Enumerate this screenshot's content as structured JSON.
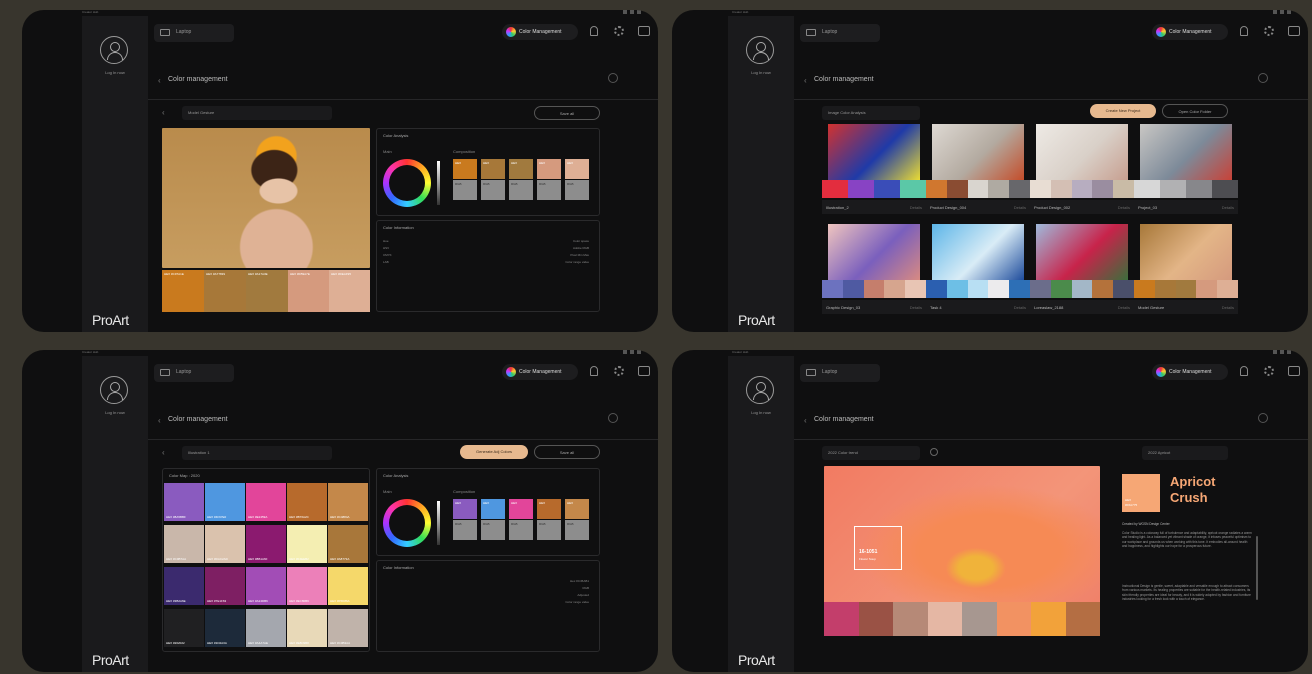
{
  "panels": {
    "common": {
      "login_label": "Log In now",
      "proart": "ProArt",
      "laptop": "Laptop",
      "color_management_chip": "Color Management",
      "page_title": "Color management",
      "window_title": "Creator Hub"
    },
    "p1": {
      "dropdown": "Model Gesture",
      "button": "Save all",
      "color_analysis_title": "Color Analysis",
      "color_wheel_label": "Main",
      "swatch_label": "Composition",
      "color_info_title": "Color Information",
      "info_rows": [
        "Hue",
        "HSV",
        "CMYK",
        "LAB"
      ],
      "info_values": [
        "Color space",
        "Adobe RGB",
        "Pixel Min Max",
        "Color range value"
      ],
      "palette": [
        {
          "hex": "#c97a1e",
          "label": "HEX #C97A1E"
        },
        {
          "hex": "#a77839",
          "label": "HEX #A77839"
        },
        {
          "hex": "#a17a3e",
          "label": "HEX #A17A3E"
        },
        {
          "hex": "#d59a7e",
          "label": "HEX #D59A7E"
        },
        {
          "hex": "#deaf95",
          "label": "HEX #DEAF95"
        }
      ],
      "tiles": [
        "#c97a1e",
        "#a77839",
        "#a17a3e",
        "#d59a7e",
        "#deaf95"
      ]
    },
    "p2": {
      "dropdown": "Image Color Analysis",
      "gold_button": "Create New Project",
      "outline_button": "Open Color Folder",
      "cards": [
        {
          "name": "Illustration_2",
          "meta": "Details",
          "strip": [
            "#e32d3e",
            "#8843c4",
            "#3a4db8",
            "#5bc8a7"
          ],
          "img": [
            "#d2322f",
            "#1f3aa8",
            "#e9db34"
          ]
        },
        {
          "name": "Product Design_004",
          "meta": "Details",
          "strip": [
            "#d0772f",
            "#8a4c32",
            "#d9d5cf",
            "#afaaa2",
            "#67676b"
          ],
          "img": [
            "#ded9d3",
            "#b3aaa0",
            "#c44d2a"
          ]
        },
        {
          "name": "Product Design_002",
          "meta": "Details",
          "strip": [
            "#e8ddd3",
            "#d4bfb4",
            "#b7adc0",
            "#9a8da0",
            "#c9bba6"
          ],
          "img": [
            "#eeeae5",
            "#d9d0c8",
            "#c79f90"
          ]
        },
        {
          "name": "Project_03",
          "meta": "Details",
          "strip": [
            "#d7d7d7",
            "#b1b1b3",
            "#87878b",
            "#4d4d51"
          ],
          "img": [
            "#c9c7c4",
            "#7d8a99",
            "#c84238"
          ]
        },
        {
          "name": "Graphic Design_03",
          "meta": "Details",
          "strip": [
            "#6c72bf",
            "#4f5aa2",
            "#c57e6c",
            "#d6a58e",
            "#e8c5b4"
          ],
          "img": [
            "#f0c5bf",
            "#7a5fbd",
            "#d88a82"
          ]
        },
        {
          "name": "Task 4",
          "meta": "Details",
          "strip": [
            "#2b5fb0",
            "#6dbfe6",
            "#b8dff3",
            "#ecebed",
            "#2d6fb6"
          ],
          "img": [
            "#5cb5e8",
            "#d9ecf6",
            "#1e4c9c"
          ]
        },
        {
          "name": "Loreaslaw_2188",
          "meta": "Details",
          "strip": [
            "#6b6d8b",
            "#4b8b4b",
            "#a3b7c7",
            "#b4723b",
            "#4a4f6a"
          ],
          "img": [
            "#9fbadc",
            "#c8234a",
            "#3c6e3c"
          ]
        },
        {
          "name": "Model Gesture",
          "meta": "Details",
          "strip": [
            "#c97a1e",
            "#a77839",
            "#a17a3e",
            "#d59a7e",
            "#deaf95"
          ],
          "img": [
            "#a77839",
            "#e3b587",
            "#d59a7e"
          ]
        }
      ]
    },
    "p3": {
      "dropdown": "Illustration 1",
      "gold_button": "Generate Adj Colors",
      "outline_button": "Save all",
      "grid_title": "Color Map : 2020",
      "color_analysis_title": "Color Analysis",
      "color_wheel_label": "Main",
      "swatch_label": "Composition",
      "color_info_title": "Color Information",
      "info_values": [
        "Hex #C45AB1",
        "RGB",
        "Adjusted",
        "Color range value"
      ],
      "grid": [
        {
          "hex": "#8a5bbf",
          "label": "HEX #8A5BBF"
        },
        {
          "hex": "#4f97e0",
          "label": "HEX #4F97E0"
        },
        {
          "hex": "#e2459a",
          "label": "HEX #E2459A"
        },
        {
          "hex": "#b76a2c",
          "label": "HEX #B76A2C"
        },
        {
          "hex": "#c4884a",
          "label": "HEX #C4884A"
        },
        {
          "hex": "#c9b7aa",
          "label": "HEX #C9B7AA"
        },
        {
          "hex": "#dac2ad",
          "label": "HEX #DAC2AD"
        },
        {
          "hex": "#8b1a6f",
          "label": "HEX #8B1A6F"
        },
        {
          "hex": "#f4eeb2",
          "label": "HEX #F4EEB2"
        },
        {
          "hex": "#a8773a",
          "label": "HEX #A8773A"
        },
        {
          "hex": "#3b2a6e",
          "label": "HEX #3B2A6E"
        },
        {
          "hex": "#7e1f63",
          "label": "HEX #7E1F63"
        },
        {
          "hex": "#a24db6",
          "label": "HEX #A24DB6"
        },
        {
          "hex": "#ec80b9",
          "label": "HEX #EC80B9"
        },
        {
          "hex": "#f5d86a",
          "label": "HEX #F5D86A"
        },
        {
          "hex": "#202022",
          "label": "HEX #202022"
        },
        {
          "hex": "#1d2a3a",
          "label": "HEX #1D2A3A"
        },
        {
          "hex": "#a4a7ae",
          "label": "HEX #A4A7AE"
        },
        {
          "hex": "#e8d9b8",
          "label": "HEX #E8D9B8"
        },
        {
          "hex": "#c0b3aa",
          "label": "HEX #C0B3AA"
        }
      ],
      "tiles": [
        "#8a5bbf",
        "#4f97e0",
        "#e2459a",
        "#b76a2c",
        "#c4884a"
      ]
    },
    "p4": {
      "dropdown": "2022 Color trend",
      "right_dropdown": "2022 Apricot",
      "apricot_title_1": "Apricot",
      "apricot_title_2": "Crush",
      "apricot_swatch_hex": "HEX",
      "apricot_swatch_code": "#F6A775",
      "overlay_code": "16-1051",
      "overlay_name": "Flower Soup",
      "credit": "Created by WGSN Design Center",
      "body1": "Color Studio is a colorway full of turbulence and adaptability, apricot orange radiates a warm and healing light. As a balanced yet vibrant shade of orange, it infuses peaceful optimism to our workplace and grounds us when working with this tone. It embodies all-around health and happiness, and highlights our hope for a prosperous future.",
      "body2": "Instructional Design is gentle, sweet, adaptable and versatile enough to attract consumers from various markets. Its healing properties are suitable for the health-related industries, its skin friendly properties are ideal for beauty, and it is widely adopted by fashion and furniture industries looking for a fresh look with a touch of elegance.",
      "strip": [
        "#c33e6b",
        "#9a5245",
        "#b68977",
        "#e5b7a4",
        "#a79790",
        "#f29262",
        "#f2a23a",
        "#b46e43"
      ]
    }
  }
}
